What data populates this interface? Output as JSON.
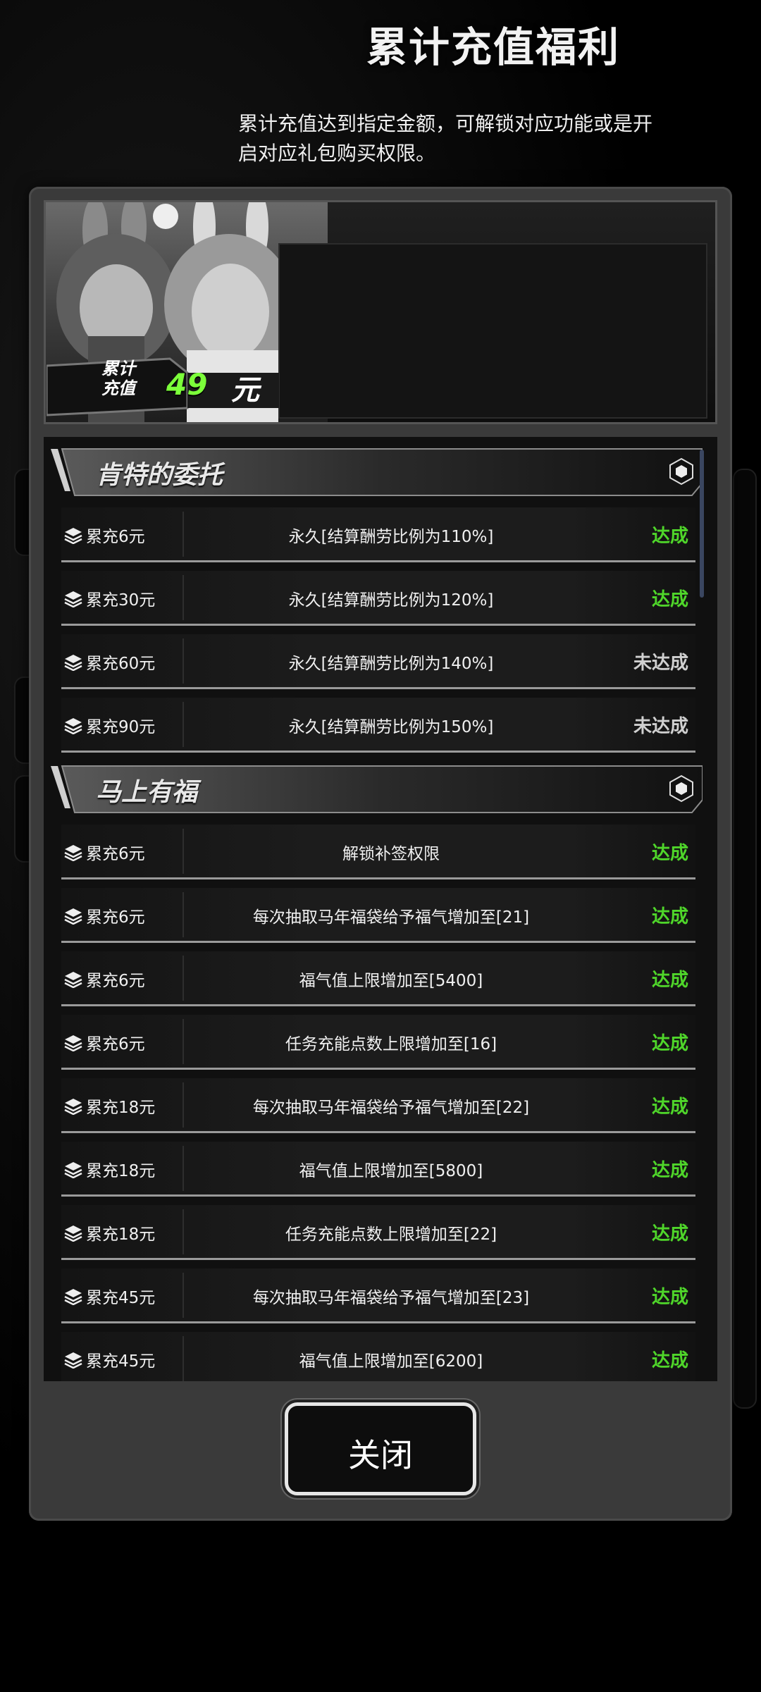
{
  "header": {
    "title": "累计充值福利",
    "description": "累计充值达到指定金额，可解锁对应功能或是开启对应礼包购买权限。",
    "total_label_line1": "累计",
    "total_label_line2": "充值",
    "total_value": "49",
    "total_unit": "元"
  },
  "sections": [
    {
      "title": "肯特的委托",
      "rows": [
        {
          "amount": "累充6元",
          "desc": "永久[结算酬劳比例为110%]",
          "status": "达成",
          "done": true
        },
        {
          "amount": "累充30元",
          "desc": "永久[结算酬劳比例为120%]",
          "status": "达成",
          "done": true
        },
        {
          "amount": "累充60元",
          "desc": "永久[结算酬劳比例为140%]",
          "status": "未达成",
          "done": false
        },
        {
          "amount": "累充90元",
          "desc": "永久[结算酬劳比例为150%]",
          "status": "未达成",
          "done": false
        }
      ]
    },
    {
      "title": "马上有福",
      "rows": [
        {
          "amount": "累充6元",
          "desc": "解锁补签权限",
          "status": "达成",
          "done": true
        },
        {
          "amount": "累充6元",
          "desc": "每次抽取马年福袋给予福气增加至[21]",
          "status": "达成",
          "done": true
        },
        {
          "amount": "累充6元",
          "desc": "福气值上限增加至[5400]",
          "status": "达成",
          "done": true
        },
        {
          "amount": "累充6元",
          "desc": "任务充能点数上限增加至[16]",
          "status": "达成",
          "done": true
        },
        {
          "amount": "累充18元",
          "desc": "每次抽取马年福袋给予福气增加至[22]",
          "status": "达成",
          "done": true
        },
        {
          "amount": "累充18元",
          "desc": "福气值上限增加至[5800]",
          "status": "达成",
          "done": true
        },
        {
          "amount": "累充18元",
          "desc": "任务充能点数上限增加至[22]",
          "status": "达成",
          "done": true
        },
        {
          "amount": "累充45元",
          "desc": "每次抽取马年福袋给予福气增加至[23]",
          "status": "达成",
          "done": true
        },
        {
          "amount": "累充45元",
          "desc": "福气值上限增加至[6200]",
          "status": "达成",
          "done": true
        }
      ]
    }
  ],
  "close_button": {
    "label": "关闭"
  },
  "colors": {
    "done": "#4fd62a",
    "not_done": "#d0d0d0",
    "accent_value": "#7cff3a"
  }
}
